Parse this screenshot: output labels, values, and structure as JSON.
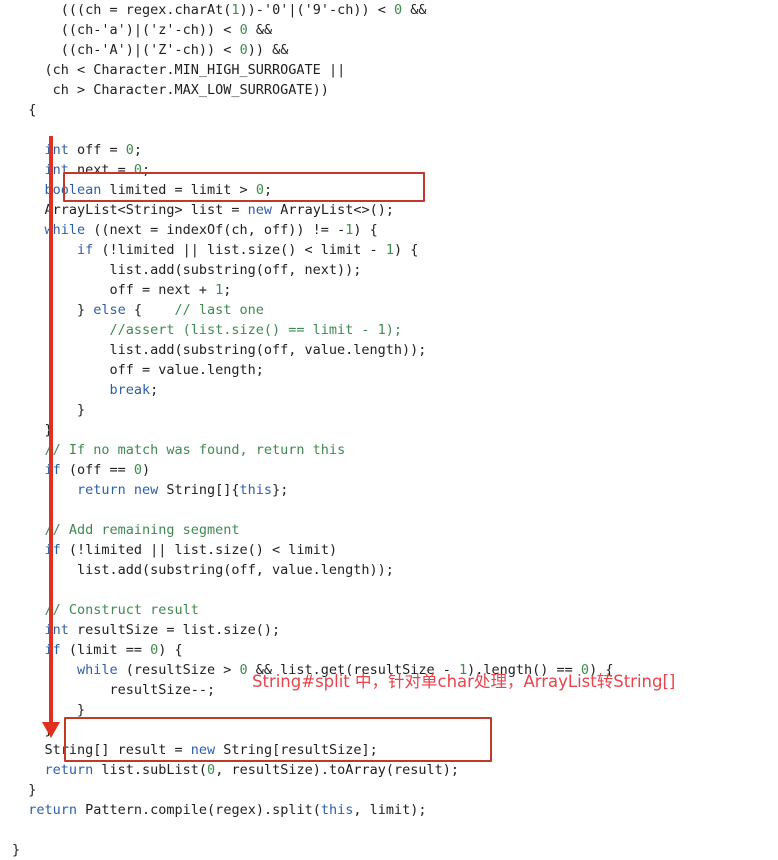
{
  "editor": {
    "language": "java",
    "background_color": "#ffffff",
    "keyword_color": "#2c5fa8",
    "comment_color": "#3f8a52",
    "number_color": "#3e8b4e",
    "text_color": "#1f1f1f"
  },
  "code_lines": [
    {
      "indent": 6,
      "segments": [
        {
          "t": "(((ch = regex.charAt(",
          "c": "plain"
        },
        {
          "t": "1",
          "c": "num"
        },
        {
          "t": "))-",
          "c": "plain"
        },
        {
          "t": "'0'",
          "c": "chr"
        },
        {
          "t": "|(",
          "c": "plain"
        },
        {
          "t": "'9'",
          "c": "chr"
        },
        {
          "t": "-ch)) < ",
          "c": "plain"
        },
        {
          "t": "0",
          "c": "num"
        },
        {
          "t": " &&",
          "c": "plain"
        }
      ]
    },
    {
      "indent": 6,
      "segments": [
        {
          "t": "((ch-",
          "c": "plain"
        },
        {
          "t": "'a'",
          "c": "chr"
        },
        {
          "t": ")|(",
          "c": "plain"
        },
        {
          "t": "'z'",
          "c": "chr"
        },
        {
          "t": "-ch)) < ",
          "c": "plain"
        },
        {
          "t": "0",
          "c": "num"
        },
        {
          "t": " &&",
          "c": "plain"
        }
      ]
    },
    {
      "indent": 6,
      "segments": [
        {
          "t": "((ch-",
          "c": "plain"
        },
        {
          "t": "'A'",
          "c": "chr"
        },
        {
          "t": ")|(",
          "c": "plain"
        },
        {
          "t": "'Z'",
          "c": "chr"
        },
        {
          "t": "-ch)) < ",
          "c": "plain"
        },
        {
          "t": "0",
          "c": "num"
        },
        {
          "t": ")) &&",
          "c": "plain"
        }
      ]
    },
    {
      "indent": 4,
      "segments": [
        {
          "t": "(ch < Character.MIN_HIGH_SURROGATE ||",
          "c": "plain"
        }
      ]
    },
    {
      "indent": 5,
      "segments": [
        {
          "t": "ch > Character.MAX_LOW_SURROGATE))",
          "c": "plain"
        }
      ]
    },
    {
      "indent": 2,
      "segments": [
        {
          "t": "{",
          "c": "plain"
        }
      ]
    },
    {
      "indent": 0,
      "segments": []
    },
    {
      "indent": 4,
      "segments": [
        {
          "t": "int",
          "c": "kw"
        },
        {
          "t": " off = ",
          "c": "plain"
        },
        {
          "t": "0",
          "c": "num"
        },
        {
          "t": ";",
          "c": "plain"
        }
      ]
    },
    {
      "indent": 4,
      "segments": [
        {
          "t": "int",
          "c": "kw"
        },
        {
          "t": " next = ",
          "c": "plain"
        },
        {
          "t": "0",
          "c": "num"
        },
        {
          "t": ";",
          "c": "plain"
        }
      ]
    },
    {
      "indent": 4,
      "segments": [
        {
          "t": "boolean",
          "c": "kw"
        },
        {
          "t": " limited = limit > ",
          "c": "plain"
        },
        {
          "t": "0",
          "c": "num"
        },
        {
          "t": ";",
          "c": "plain"
        }
      ]
    },
    {
      "indent": 4,
      "segments": [
        {
          "t": "ArrayList<String> list = ",
          "c": "plain"
        },
        {
          "t": "new",
          "c": "kw"
        },
        {
          "t": " ArrayList<>();",
          "c": "plain"
        }
      ]
    },
    {
      "indent": 4,
      "segments": [
        {
          "t": "while",
          "c": "kw"
        },
        {
          "t": " ((next = indexOf(ch, off)) != -",
          "c": "plain"
        },
        {
          "t": "1",
          "c": "num"
        },
        {
          "t": ") {",
          "c": "plain"
        }
      ]
    },
    {
      "indent": 8,
      "segments": [
        {
          "t": "if",
          "c": "kw"
        },
        {
          "t": " (!limited || list.size() < limit - ",
          "c": "plain"
        },
        {
          "t": "1",
          "c": "num"
        },
        {
          "t": ") {",
          "c": "plain"
        }
      ]
    },
    {
      "indent": 12,
      "segments": [
        {
          "t": "list.add(substring(off, next));",
          "c": "plain"
        }
      ]
    },
    {
      "indent": 12,
      "segments": [
        {
          "t": "off = next + ",
          "c": "plain"
        },
        {
          "t": "1",
          "c": "num"
        },
        {
          "t": ";",
          "c": "plain"
        }
      ]
    },
    {
      "indent": 8,
      "segments": [
        {
          "t": "} ",
          "c": "plain"
        },
        {
          "t": "else",
          "c": "kw"
        },
        {
          "t": " {    ",
          "c": "plain"
        },
        {
          "t": "// last one",
          "c": "cmt"
        }
      ]
    },
    {
      "indent": 12,
      "segments": [
        {
          "t": "//assert (list.size() == limit - 1);",
          "c": "cmt"
        }
      ]
    },
    {
      "indent": 12,
      "segments": [
        {
          "t": "list.add(substring(off, value.length));",
          "c": "plain"
        }
      ]
    },
    {
      "indent": 12,
      "segments": [
        {
          "t": "off = value.length;",
          "c": "plain"
        }
      ]
    },
    {
      "indent": 12,
      "segments": [
        {
          "t": "break",
          "c": "kw"
        },
        {
          "t": ";",
          "c": "plain"
        }
      ]
    },
    {
      "indent": 8,
      "segments": [
        {
          "t": "}",
          "c": "plain"
        }
      ]
    },
    {
      "indent": 4,
      "segments": [
        {
          "t": "}",
          "c": "plain"
        }
      ]
    },
    {
      "indent": 4,
      "segments": [
        {
          "t": "// If no match was found, return this",
          "c": "cmt"
        }
      ]
    },
    {
      "indent": 4,
      "segments": [
        {
          "t": "if",
          "c": "kw"
        },
        {
          "t": " (off == ",
          "c": "plain"
        },
        {
          "t": "0",
          "c": "num"
        },
        {
          "t": ")",
          "c": "plain"
        }
      ]
    },
    {
      "indent": 8,
      "segments": [
        {
          "t": "return",
          "c": "kw"
        },
        {
          "t": " ",
          "c": "plain"
        },
        {
          "t": "new",
          "c": "kw"
        },
        {
          "t": " String[]{",
          "c": "plain"
        },
        {
          "t": "this",
          "c": "kw"
        },
        {
          "t": "};",
          "c": "plain"
        }
      ]
    },
    {
      "indent": 0,
      "segments": []
    },
    {
      "indent": 4,
      "segments": [
        {
          "t": "// Add remaining segment",
          "c": "cmt"
        }
      ]
    },
    {
      "indent": 4,
      "segments": [
        {
          "t": "if",
          "c": "kw"
        },
        {
          "t": " (!limited || list.size() < limit)",
          "c": "plain"
        }
      ]
    },
    {
      "indent": 8,
      "segments": [
        {
          "t": "list.add(substring(off, value.length));",
          "c": "plain"
        }
      ]
    },
    {
      "indent": 0,
      "segments": []
    },
    {
      "indent": 4,
      "segments": [
        {
          "t": "// Construct result",
          "c": "cmt"
        }
      ]
    },
    {
      "indent": 4,
      "segments": [
        {
          "t": "int",
          "c": "kw"
        },
        {
          "t": " resultSize = list.size();",
          "c": "plain"
        }
      ]
    },
    {
      "indent": 4,
      "segments": [
        {
          "t": "if",
          "c": "kw"
        },
        {
          "t": " (limit == ",
          "c": "plain"
        },
        {
          "t": "0",
          "c": "num"
        },
        {
          "t": ") {",
          "c": "plain"
        }
      ]
    },
    {
      "indent": 8,
      "segments": [
        {
          "t": "while",
          "c": "kw"
        },
        {
          "t": " (resultSize > ",
          "c": "plain"
        },
        {
          "t": "0",
          "c": "num"
        },
        {
          "t": " && list.get(resultSize - ",
          "c": "plain"
        },
        {
          "t": "1",
          "c": "num"
        },
        {
          "t": ").length() == ",
          "c": "plain"
        },
        {
          "t": "0",
          "c": "num"
        },
        {
          "t": ") {",
          "c": "plain"
        }
      ]
    },
    {
      "indent": 12,
      "segments": [
        {
          "t": "resultSize--;",
          "c": "plain"
        }
      ]
    },
    {
      "indent": 8,
      "segments": [
        {
          "t": "}",
          "c": "plain"
        }
      ]
    },
    {
      "indent": 4,
      "segments": [
        {
          "t": "}",
          "c": "plain"
        }
      ]
    },
    {
      "indent": 4,
      "segments": [
        {
          "t": "String[] result = ",
          "c": "plain"
        },
        {
          "t": "new",
          "c": "kw"
        },
        {
          "t": " String[resultSize];",
          "c": "plain"
        }
      ]
    },
    {
      "indent": 4,
      "segments": [
        {
          "t": "return",
          "c": "kw"
        },
        {
          "t": " list.subList(",
          "c": "plain"
        },
        {
          "t": "0",
          "c": "num"
        },
        {
          "t": ", resultSize).toArray(result);",
          "c": "plain"
        }
      ]
    },
    {
      "indent": 2,
      "segments": [
        {
          "t": "}",
          "c": "plain"
        }
      ]
    },
    {
      "indent": 2,
      "segments": [
        {
          "t": "return",
          "c": "kw"
        },
        {
          "t": " Pattern.compile(regex).split(",
          "c": "plain"
        },
        {
          "t": "this",
          "c": "kw"
        },
        {
          "t": ", limit);",
          "c": "plain"
        }
      ]
    },
    {
      "indent": 0,
      "segments": []
    },
    {
      "indent": 0,
      "segments": [
        {
          "t": "}",
          "c": "plain"
        }
      ]
    }
  ],
  "annotations": {
    "color": "#c0392b",
    "arrow_color": "#e03020",
    "note_color": "#e8444c",
    "note_text": "String#split 中，针对单char处理，ArrayList转String[]",
    "highlight_box_1_label": "ArrayList<String> list = new ArrayList<>();",
    "highlight_box_2_label": "String[] result = new String[resultSize]; return list.subList(0, resultSize).toArray(result);"
  }
}
